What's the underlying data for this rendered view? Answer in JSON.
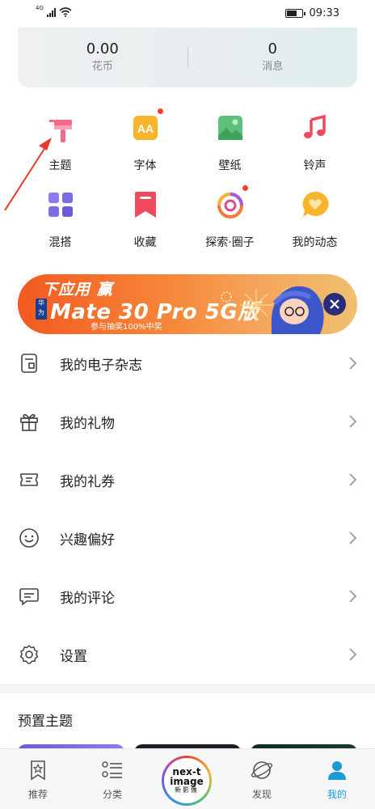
{
  "status_bar": {
    "network": "4G",
    "time": "09:33"
  },
  "stats": [
    {
      "value": "0.00",
      "label": "花币"
    },
    {
      "value": "0",
      "label": "消息"
    }
  ],
  "grid": [
    {
      "label": "主题",
      "icon": "brush-icon",
      "badge": false
    },
    {
      "label": "字体",
      "icon": "font-icon",
      "badge": true
    },
    {
      "label": "壁纸",
      "icon": "wallpaper-icon",
      "badge": false
    },
    {
      "label": "铃声",
      "icon": "music-note-icon",
      "badge": false
    },
    {
      "label": "混搭",
      "icon": "mix-grid-icon",
      "badge": false
    },
    {
      "label": "收藏",
      "icon": "bookmark-icon",
      "badge": false
    },
    {
      "label": "探索·圈子",
      "icon": "explore-circle-icon",
      "badge": true
    },
    {
      "label": "我的动态",
      "icon": "heart-bubble-icon",
      "badge": false
    }
  ],
  "banner": {
    "title": "下应用 赢",
    "brand": "华为",
    "product": "Mate 30 Pro 5G版",
    "note": "参与抽奖100%中奖"
  },
  "menu": [
    {
      "label": "我的电子杂志",
      "icon": "magazine-icon"
    },
    {
      "label": "我的礼物",
      "icon": "gift-icon"
    },
    {
      "label": "我的礼券",
      "icon": "coupon-icon"
    },
    {
      "label": "兴趣偏好",
      "icon": "smiley-icon"
    },
    {
      "label": "我的评论",
      "icon": "comment-icon"
    },
    {
      "label": "设置",
      "icon": "gear-icon"
    }
  ],
  "section": {
    "title": "预置主题"
  },
  "bottom_nav": {
    "items": [
      {
        "label": "推荐",
        "icon": "star-bookmark-icon"
      },
      {
        "label": "分类",
        "icon": "category-list-icon"
      },
      {
        "label": "发现",
        "icon": "planet-icon"
      },
      {
        "label": "我的",
        "icon": "person-icon",
        "active": true
      }
    ],
    "center": {
      "line1": "nex-t",
      "line2": "image",
      "line3": "新影像"
    }
  },
  "colors": {
    "accent": "#1a9bd8",
    "badge": "#ff3b30",
    "annotation": "#e8392c"
  }
}
